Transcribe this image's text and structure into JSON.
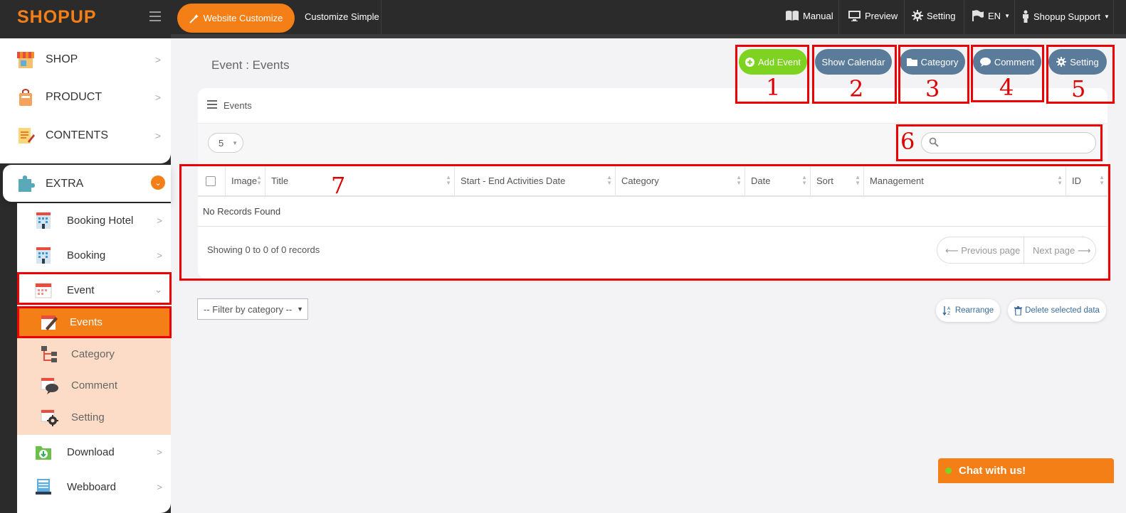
{
  "app": {
    "logo": "SHOPUP"
  },
  "topbar": {
    "customize_btn": "Website Customize",
    "customize_simple": "Customize Simple",
    "manual": "Manual",
    "preview": "Preview",
    "setting": "Setting",
    "language": "EN",
    "support": "Shopup Support"
  },
  "sidebar": {
    "shop": "SHOP",
    "product": "PRODUCT",
    "contents": "CONTENTS",
    "extra": "EXTRA",
    "booking_hotel": "Booking Hotel",
    "booking": "Booking",
    "event": "Event",
    "events": "Events",
    "category": "Category",
    "comment": "Comment",
    "setting": "Setting",
    "download": "Download",
    "webboard": "Webboard"
  },
  "main": {
    "title": "Event : Events",
    "actions": {
      "add_event": "Add Event",
      "show_calendar": "Show Calendar",
      "category": "Category",
      "comment": "Comment",
      "setting": "Setting"
    },
    "annotations": [
      "1",
      "2",
      "3",
      "4",
      "5",
      "6",
      "7"
    ],
    "panel_title": "Events",
    "page_size": "5",
    "search_placeholder": "",
    "columns": [
      "Image",
      "Title",
      "Start - End Activities Date",
      "Category",
      "Date",
      "Sort",
      "Management",
      "ID"
    ],
    "empty_text": "No Records Found",
    "showing": "Showing 0 to 0 of 0 records",
    "prev_page": "⟵ Previous page",
    "next_page": "Next page ⟶",
    "filter": "-- Filter by category --",
    "rearrange": "Rearrange",
    "delete_selected": "Delete selected data"
  },
  "chat": {
    "label": "Chat with us!"
  },
  "colors": {
    "accent": "#f57f17",
    "green": "#7ed321",
    "slate": "#5b7b9a",
    "annotation": "#e00000"
  }
}
